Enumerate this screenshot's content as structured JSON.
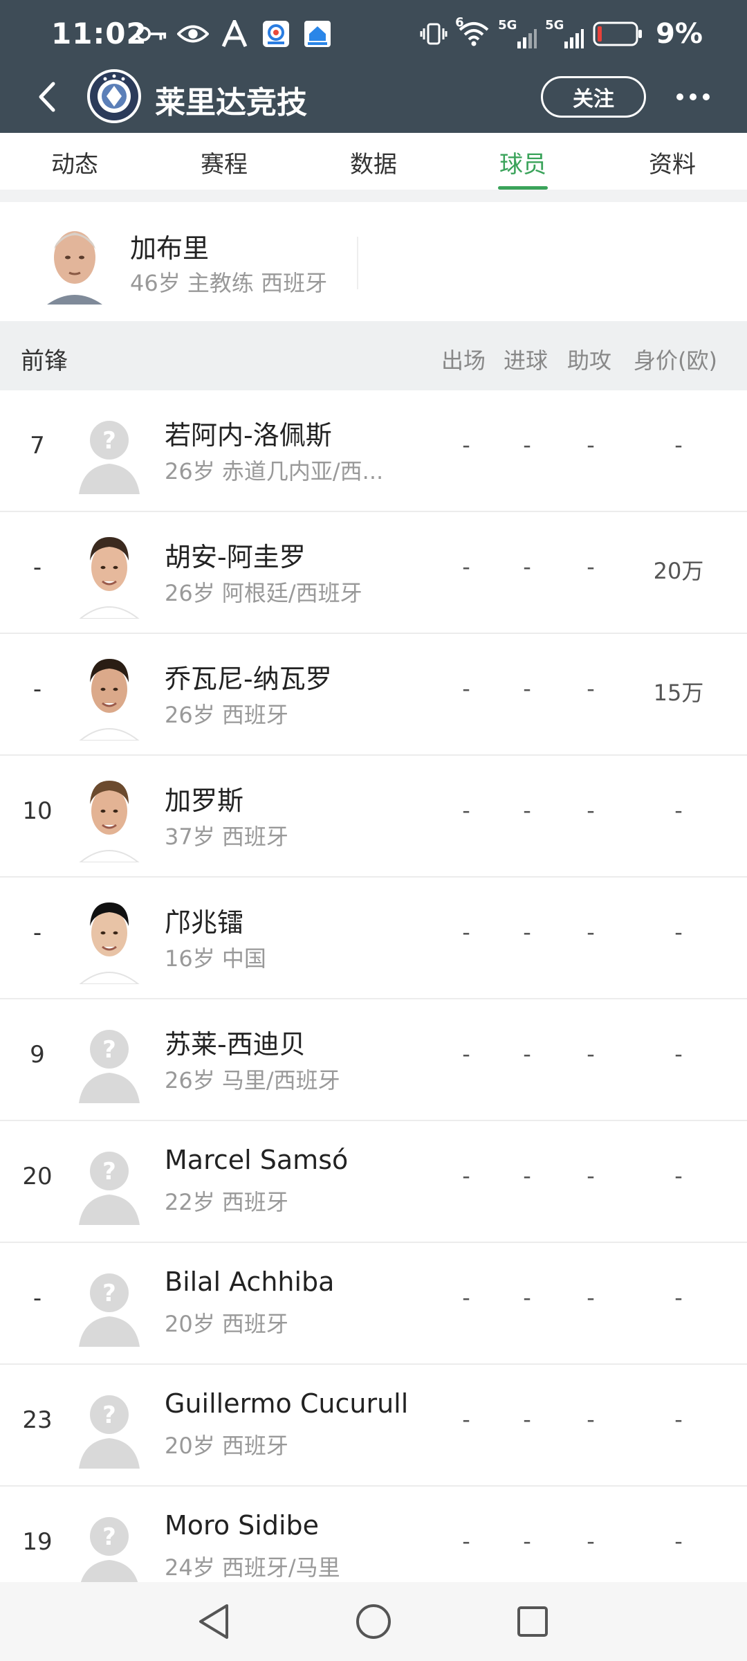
{
  "status": {
    "time": "11:02",
    "battery": "9%",
    "net1": "5G",
    "net2": "5G",
    "wifi_badge": "6"
  },
  "header": {
    "title": "莱里达竞技",
    "follow_label": "关注"
  },
  "tabs": [
    {
      "label": "动态"
    },
    {
      "label": "赛程"
    },
    {
      "label": "数据"
    },
    {
      "label": "球员",
      "active": true
    },
    {
      "label": "资料"
    }
  ],
  "coach": {
    "name": "加布里",
    "info": "46岁 主教练 西班牙"
  },
  "section": {
    "title": "前锋",
    "columns": [
      "出场",
      "进球",
      "助攻",
      "身价(欧)"
    ]
  },
  "players": [
    {
      "number": "7",
      "name": "若阿内-洛佩斯",
      "info": "26岁 赤道几内亚/西...",
      "apps": "-",
      "goals": "-",
      "assists": "-",
      "value": "-",
      "avatar": "placeholder"
    },
    {
      "number": "-",
      "name": "胡安-阿圭罗",
      "info": "26岁 阿根廷/西班牙",
      "apps": "-",
      "goals": "-",
      "assists": "-",
      "value": "20万",
      "avatar": "photo"
    },
    {
      "number": "-",
      "name": "乔瓦尼-纳瓦罗",
      "info": "26岁 西班牙",
      "apps": "-",
      "goals": "-",
      "assists": "-",
      "value": "15万",
      "avatar": "photo"
    },
    {
      "number": "10",
      "name": "加罗斯",
      "info": "37岁 西班牙",
      "apps": "-",
      "goals": "-",
      "assists": "-",
      "value": "-",
      "avatar": "photo"
    },
    {
      "number": "-",
      "name": "邝兆镭",
      "info": "16岁 中国",
      "apps": "-",
      "goals": "-",
      "assists": "-",
      "value": "-",
      "avatar": "photo"
    },
    {
      "number": "9",
      "name": "苏莱-西迪贝",
      "info": "26岁 马里/西班牙",
      "apps": "-",
      "goals": "-",
      "assists": "-",
      "value": "-",
      "avatar": "placeholder"
    },
    {
      "number": "20",
      "name": "Marcel Samsó",
      "info": "22岁 西班牙",
      "apps": "-",
      "goals": "-",
      "assists": "-",
      "value": "-",
      "avatar": "placeholder"
    },
    {
      "number": "-",
      "name": "Bilal Achhiba",
      "info": "20岁 西班牙",
      "apps": "-",
      "goals": "-",
      "assists": "-",
      "value": "-",
      "avatar": "placeholder"
    },
    {
      "number": "23",
      "name": "Guillermo Cucurull",
      "info": "20岁 西班牙",
      "apps": "-",
      "goals": "-",
      "assists": "-",
      "value": "-",
      "avatar": "placeholder"
    },
    {
      "number": "19",
      "name": "Moro Sidibe",
      "info": "24岁 西班牙/马里",
      "apps": "-",
      "goals": "-",
      "assists": "-",
      "value": "-",
      "avatar": "placeholder"
    }
  ],
  "colors": {
    "header_bg": "#3e4c57",
    "accent": "#3aa35a"
  }
}
